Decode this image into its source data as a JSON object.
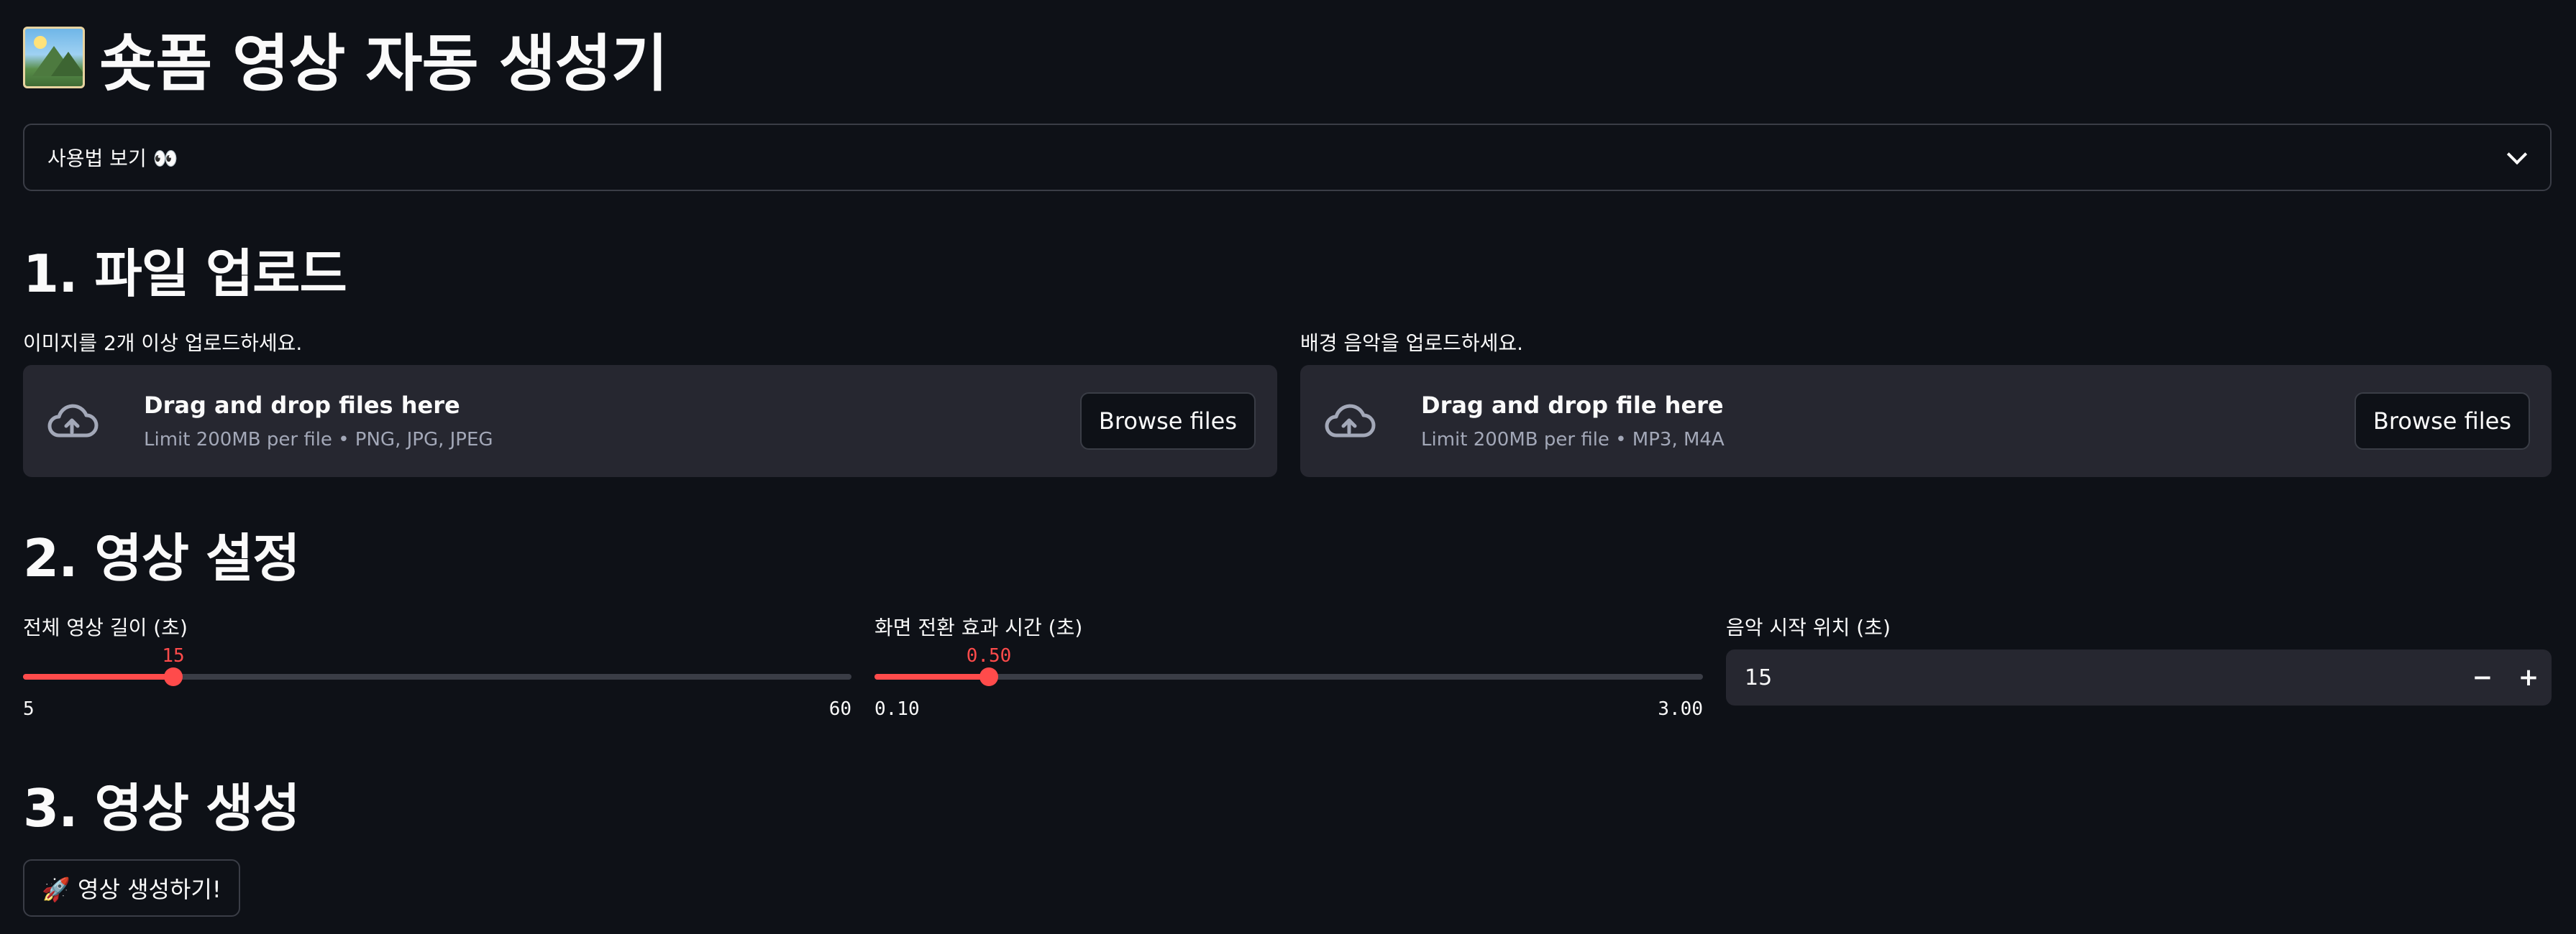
{
  "app": {
    "title": "숏폼 영상 자동 생성기",
    "title_icon": "landscape-picture-icon"
  },
  "expander": {
    "label": "사용법 보기 👀"
  },
  "section1": {
    "heading": "1. 파일 업로드",
    "image_upload": {
      "label": "이미지를 2개 이상 업로드하세요.",
      "main_text": "Drag and drop files here",
      "sub_text": "Limit 200MB per file • PNG, JPG, JPEG",
      "button_label": "Browse files"
    },
    "music_upload": {
      "label": "배경 음악을 업로드하세요.",
      "main_text": "Drag and drop file here",
      "sub_text": "Limit 200MB per file • MP3, M4A",
      "button_label": "Browse files"
    }
  },
  "section2": {
    "heading": "2. 영상 설정",
    "duration_slider": {
      "label": "전체 영상 길이 (초)",
      "value": "15",
      "min": "5",
      "max": "60",
      "fraction": 0.1818
    },
    "transition_slider": {
      "label": "화면 전환 효과 시간 (초)",
      "value": "0.50",
      "min": "0.10",
      "max": "3.00",
      "fraction": 0.1379
    },
    "music_start": {
      "label": "음악 시작 위치 (초)",
      "value": "15",
      "minus": "−",
      "plus": "+"
    }
  },
  "section3": {
    "heading": "3. 영상 생성",
    "button_label": "🚀 영상 생성하기!"
  },
  "colors": {
    "background": "#0e1117",
    "accent": "#ff4b4b",
    "widget_bg": "#262730",
    "border": "#3a3d46"
  }
}
